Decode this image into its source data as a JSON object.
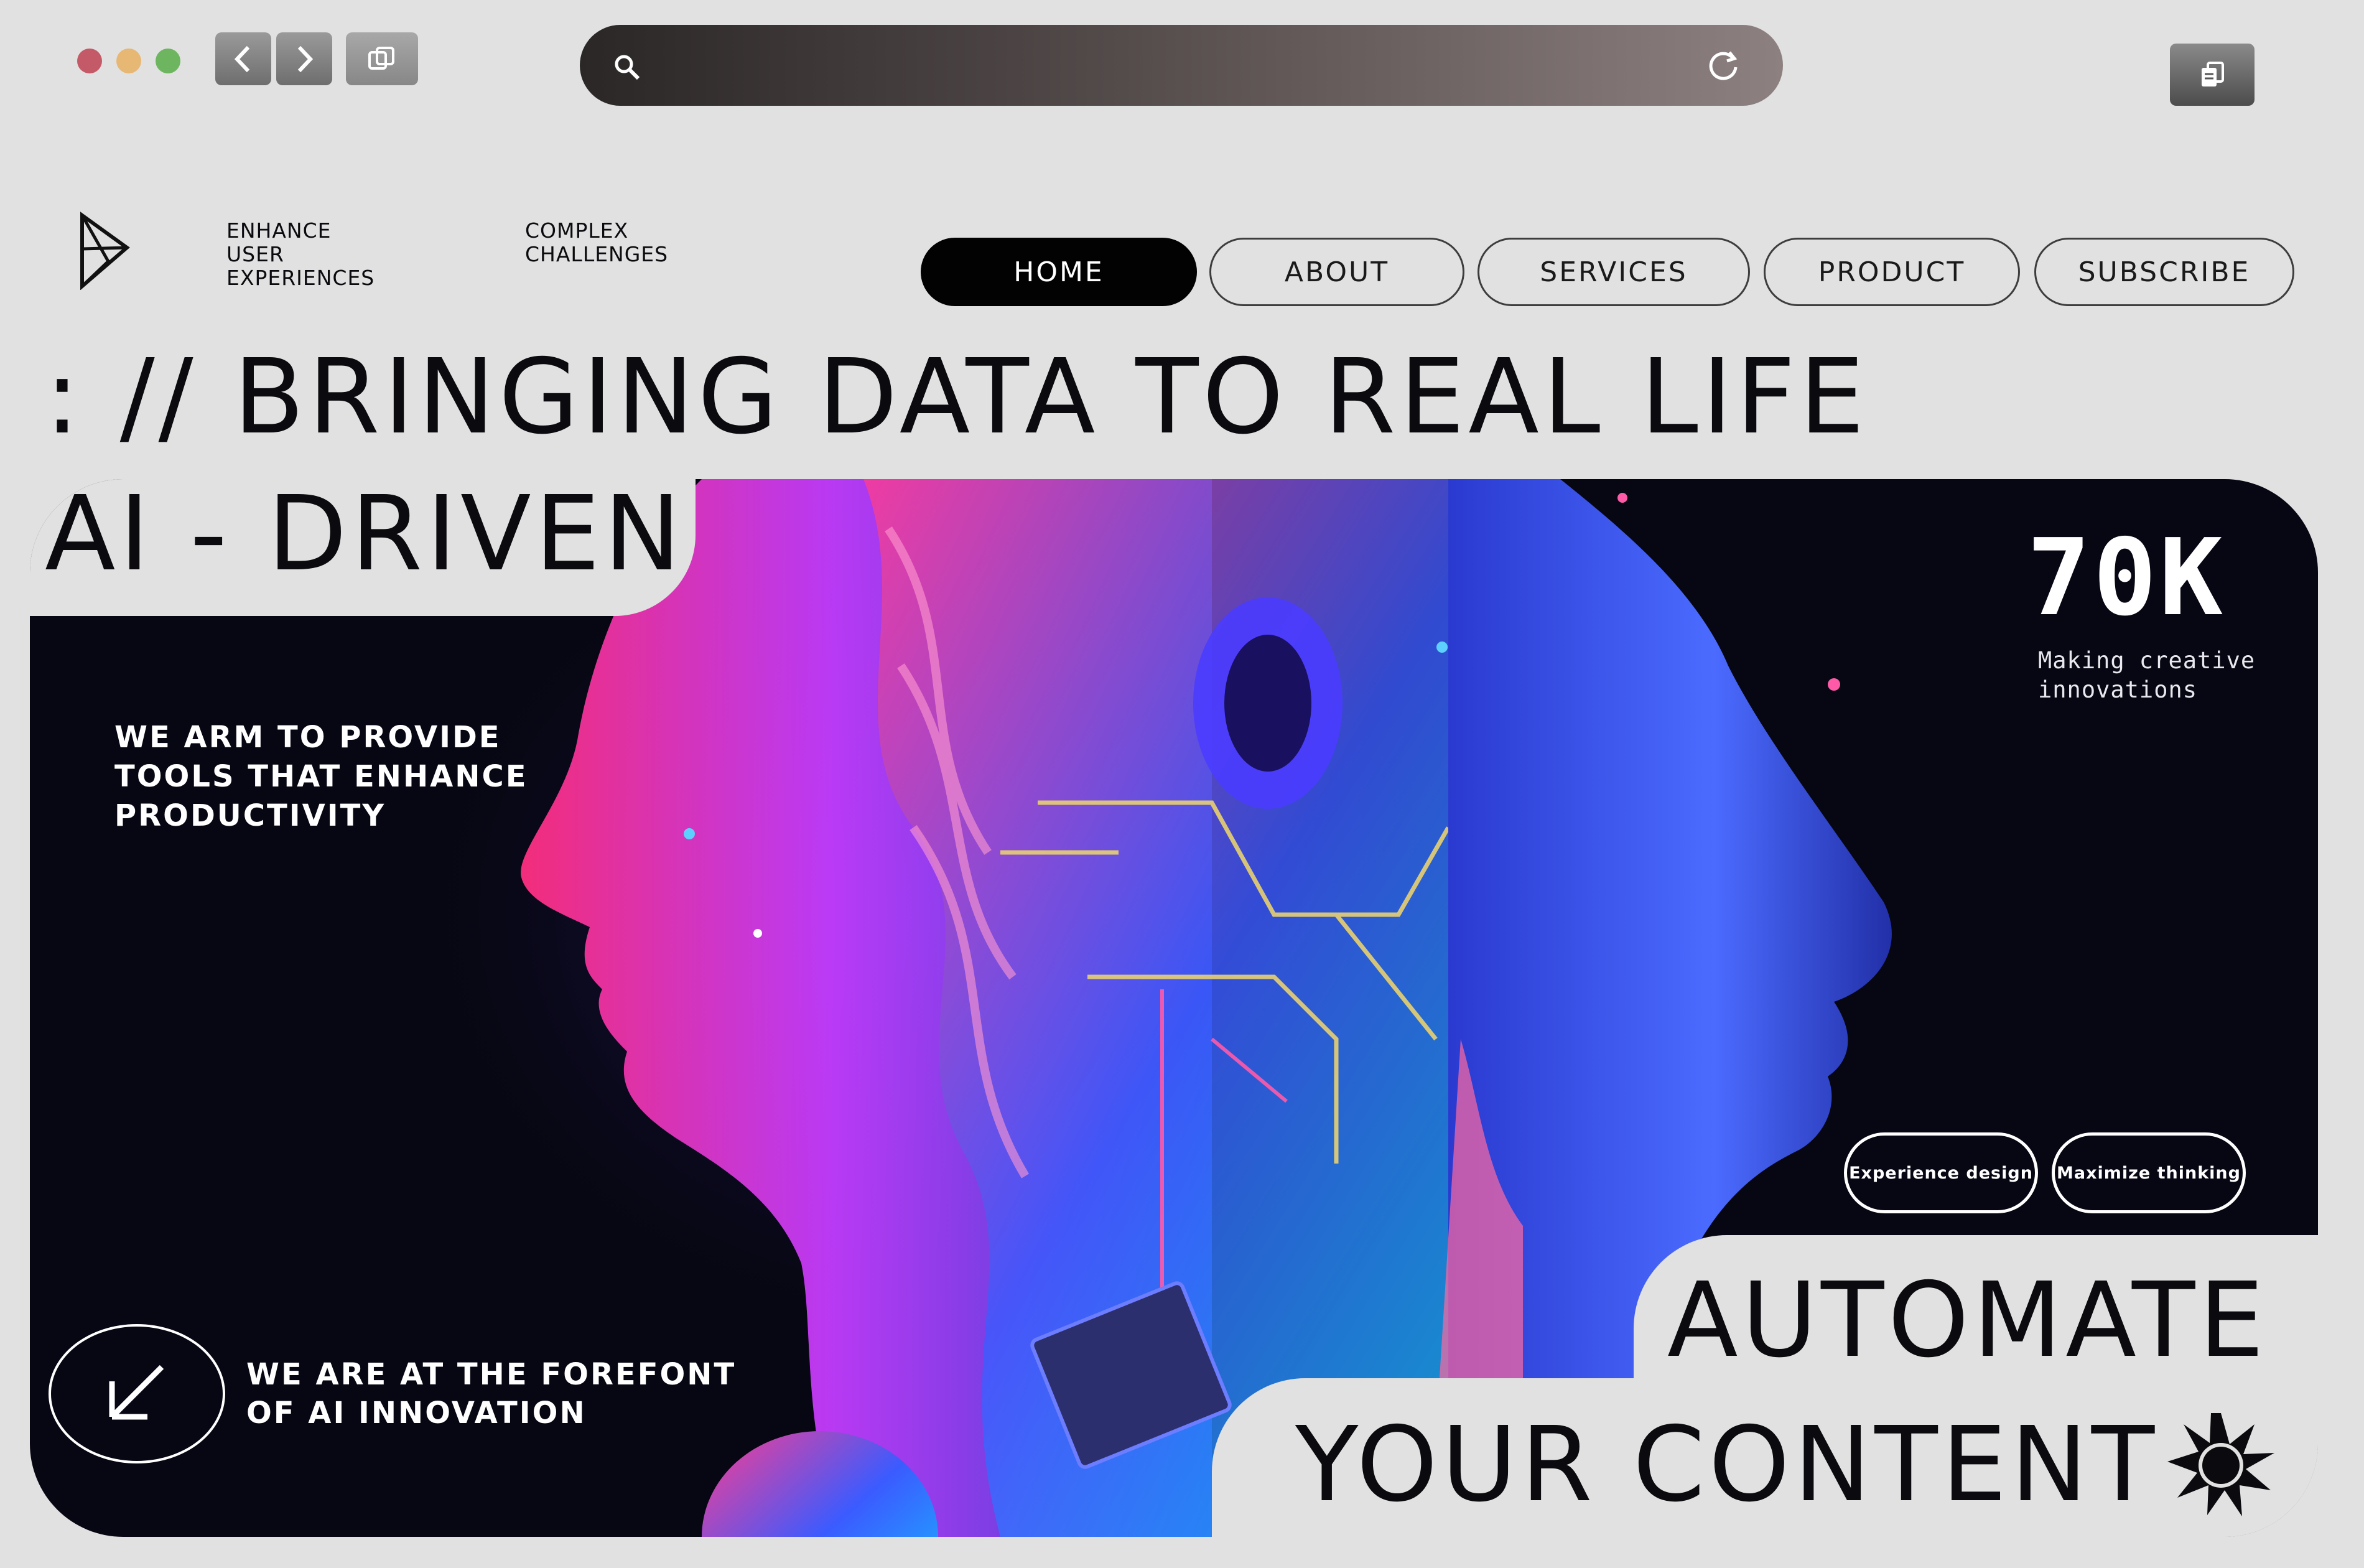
{
  "browser": {
    "window_dots": [
      "#c45a68",
      "#e7b774",
      "#6db55f"
    ],
    "back_icon": "chevron-left-icon",
    "forward_icon": "chevron-right-icon",
    "tabs_icon": "tabs-icon",
    "search_icon": "search-icon",
    "reload_icon": "reload-icon",
    "copy_icon": "copy-icon"
  },
  "header": {
    "logo": "triangle-logo",
    "tagline_1": "ENHANCE\nUSER\nEXPERIENCES",
    "tagline_2": "COMPLEX\nCHALLENGES",
    "nav": [
      {
        "label": "HOME",
        "active": true
      },
      {
        "label": "ABOUT",
        "active": false
      },
      {
        "label": "SERVICES",
        "active": false
      },
      {
        "label": "PRODUCT",
        "active": false
      },
      {
        "label": "SUBSCRIBE",
        "active": false
      }
    ]
  },
  "headline": {
    "line1": ": // BRINGING DATA TO REAL LIFE",
    "line2": "AI - DRIVEN"
  },
  "hero": {
    "mission": "WE ARM TO PROVIDE\nTOOLS THAT ENHANCE\nPRODUCTIVITY",
    "stat_value": "70K",
    "stat_label": "Making creative\ninnovations",
    "pill_1": "Experience design",
    "pill_2": "Maximize thinking",
    "forefront": "WE ARE AT THE FOREFONT\nOF AI INNOVATION",
    "arrow_icon": "arrow-down-left-icon"
  },
  "cta": {
    "line1": "AUTOMATE",
    "line2": "YOUR CONTENT",
    "star_icon": "starburst-icon"
  },
  "colors": {
    "page_bg": "#e1e1e1",
    "hero_bg": "#070713",
    "accent_pink": "#ff3c8e",
    "accent_blue": "#3b5bff",
    "accent_violet": "#7a3cff"
  }
}
